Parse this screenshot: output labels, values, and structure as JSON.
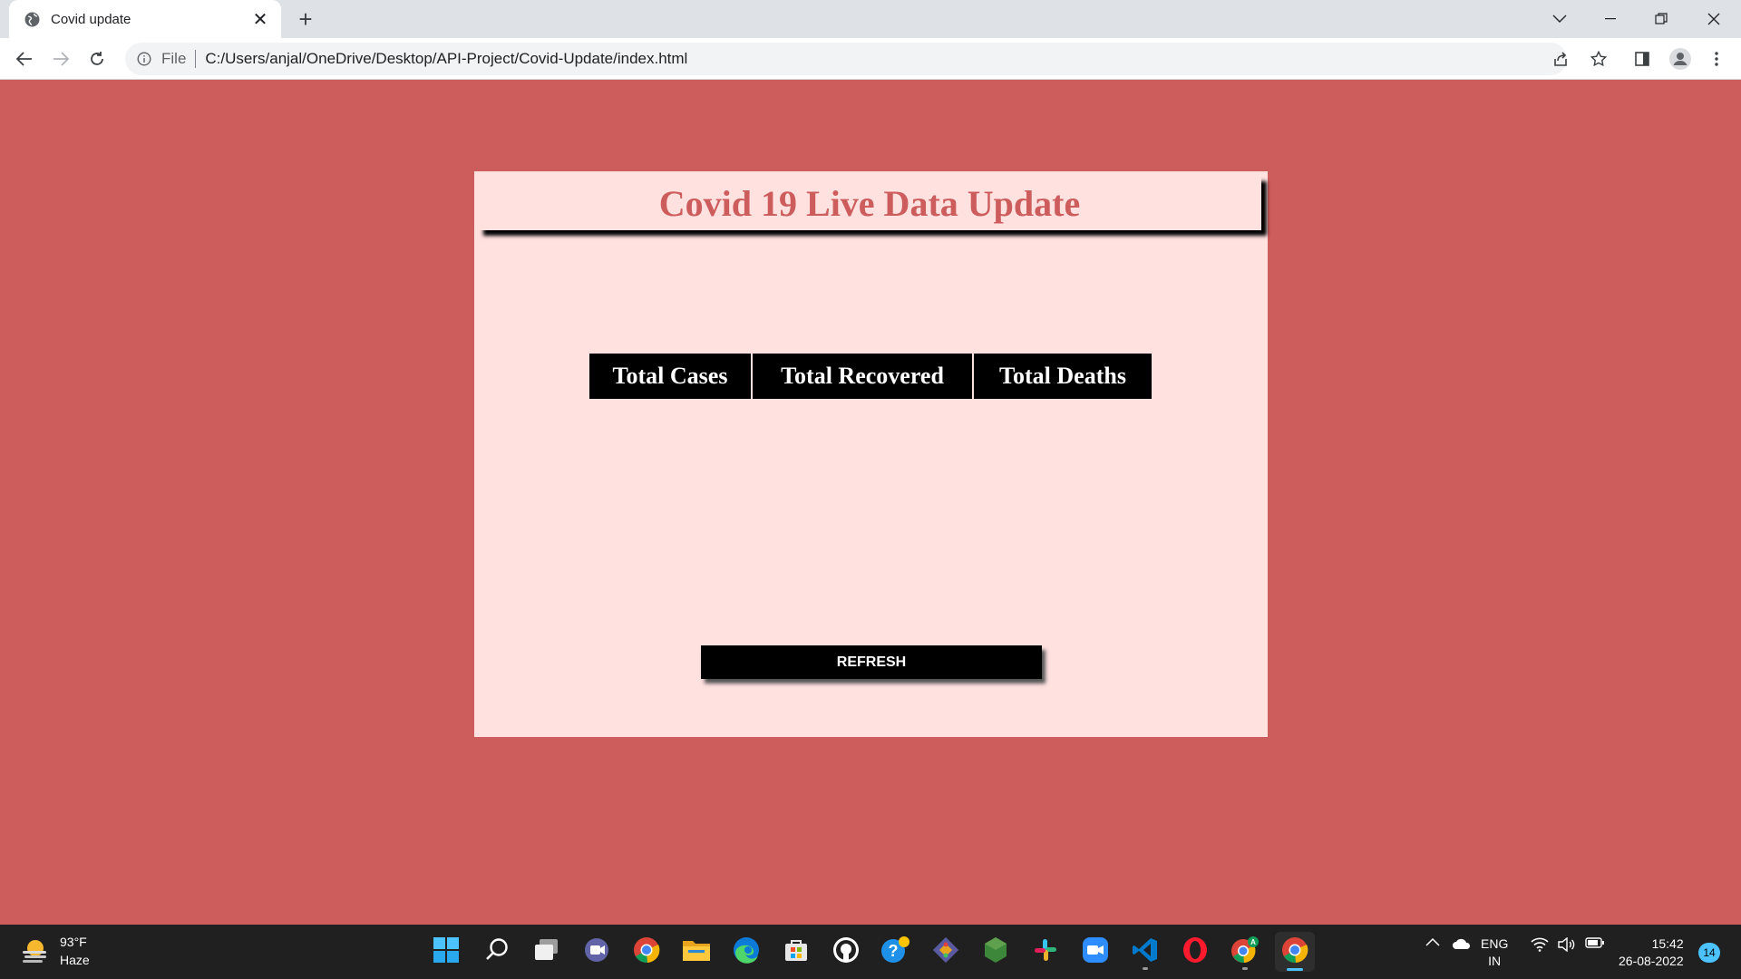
{
  "browser": {
    "tab_title": "Covid update",
    "address_scheme": "File",
    "address_url": "C:/Users/anjal/OneDrive/Desktop/API-Project/Covid-Update/index.html"
  },
  "page": {
    "title": "Covid 19 Live Data Update",
    "stats": [
      {
        "label": "Total Cases"
      },
      {
        "label": "Total Recovered"
      },
      {
        "label": "Total Deaths"
      }
    ],
    "refresh_label": "REFRESH"
  },
  "colors": {
    "page_background": "#cd5c5c",
    "card_background": "#ffe1e0",
    "title_color": "#cd5c5c",
    "stat_background": "#000000"
  },
  "taskbar": {
    "weather_temp": "93°F",
    "weather_desc": "Haze",
    "language": "ENG",
    "region": "IN",
    "time": "15:42",
    "date": "26-08-2022",
    "notification_count": "14",
    "apps": [
      "start-icon",
      "search-icon",
      "task-view-icon",
      "teams-chat-icon",
      "chrome-icon",
      "file-explorer-icon",
      "edge-icon",
      "microsoft-store-icon",
      "github-icon",
      "help-icon",
      "git-icon",
      "nodejs-icon",
      "slack-icon",
      "zoom-icon",
      "vscode-icon",
      "opera-icon",
      "chrome-profile-icon",
      "chrome-active-icon"
    ]
  }
}
